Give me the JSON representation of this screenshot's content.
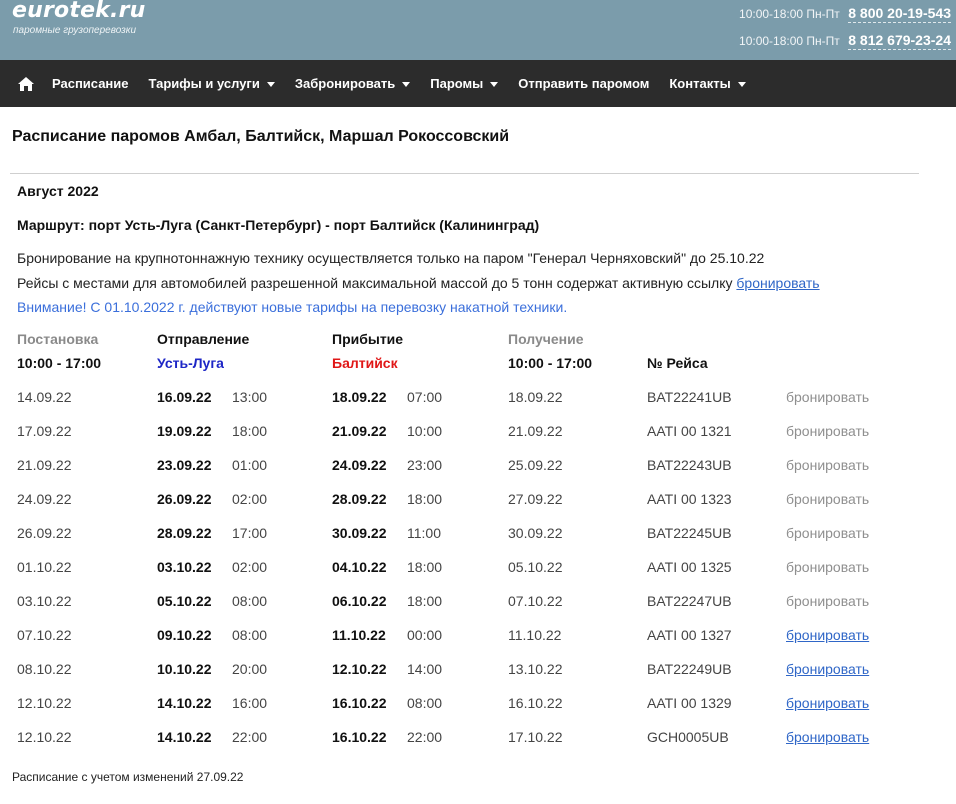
{
  "header": {
    "logo": "eurotek.ru",
    "slogan": "паромные грузоперевозки",
    "phones": [
      {
        "hours": "10:00-18:00 Пн-Пт",
        "number": "8 800 20-19-543"
      },
      {
        "hours": "10:00-18:00 Пн-Пт",
        "number": "8 812 679-23-24"
      }
    ]
  },
  "nav": {
    "home_icon": "home-icon",
    "items": [
      {
        "label": "Расписание",
        "dropdown": false
      },
      {
        "label": "Тарифы и услуги",
        "dropdown": true
      },
      {
        "label": "Забронировать",
        "dropdown": true
      },
      {
        "label": "Паромы",
        "dropdown": true
      },
      {
        "label": "Отправить паромом",
        "dropdown": false
      },
      {
        "label": "Контакты",
        "dropdown": true
      }
    ]
  },
  "page": {
    "title": "Расписание паромов Амбал, Балтийск, Маршал Рокоссовский",
    "month": "Август 2022",
    "route": "Маршрут: порт Усть-Луга (Санкт-Петербург) - порт Балтийск (Калининград)",
    "note1": "Бронирование на крупнотоннажную технику осуществляется только на паром \"Генерал Черняховский\" до 25.10.22",
    "note2_text": "Рейсы с местами для автомобилей разрешенной максимальной массой до 5 тонн содержат активную ссылку",
    "note2_link": "бронировать",
    "note3": "Внимание! С 01.10.2022 г. действуют новые тарифы на перевозку накатной техники."
  },
  "table": {
    "headers": {
      "loading": "Постановка",
      "departure": "Отправление",
      "arrival": "Прибытие",
      "pickup": "Получение"
    },
    "subheaders": {
      "loading_time": "10:00 - 17:00",
      "departure_port": "Усть-Луга",
      "arrival_port": "Балтийск",
      "pickup_time": "10:00 - 17:00",
      "voyage_no": "№ Рейса"
    },
    "rows": [
      {
        "loading": "14.09.22",
        "dep_date": "16.09.22",
        "dep_time": "13:00",
        "arr_date": "18.09.22",
        "arr_time": "07:00",
        "pickup": "18.09.22",
        "voyage": "BAT22241UB",
        "book": "бронировать",
        "active": false
      },
      {
        "loading": "17.09.22",
        "dep_date": "19.09.22",
        "dep_time": "18:00",
        "arr_date": "21.09.22",
        "arr_time": "10:00",
        "pickup": "21.09.22",
        "voyage": "AATI 00 1321",
        "book": "бронировать",
        "active": false
      },
      {
        "loading": "21.09.22",
        "dep_date": "23.09.22",
        "dep_time": "01:00",
        "arr_date": "24.09.22",
        "arr_time": "23:00",
        "pickup": "25.09.22",
        "voyage": "BAT22243UB",
        "book": "бронировать",
        "active": false
      },
      {
        "loading": "24.09.22",
        "dep_date": "26.09.22",
        "dep_time": "02:00",
        "arr_date": "28.09.22",
        "arr_time": "18:00",
        "pickup": "27.09.22",
        "voyage": "AATI 00 1323",
        "book": "бронировать",
        "active": false
      },
      {
        "loading": "26.09.22",
        "dep_date": "28.09.22",
        "dep_time": "17:00",
        "arr_date": "30.09.22",
        "arr_time": "11:00",
        "pickup": "30.09.22",
        "voyage": "BAT22245UB",
        "book": "бронировать",
        "active": false
      },
      {
        "loading": "01.10.22",
        "dep_date": "03.10.22",
        "dep_time": "02:00",
        "arr_date": "04.10.22",
        "arr_time": "18:00",
        "pickup": "05.10.22",
        "voyage": "AATI 00 1325",
        "book": "бронировать",
        "active": false
      },
      {
        "loading": "03.10.22",
        "dep_date": "05.10.22",
        "dep_time": "08:00",
        "arr_date": "06.10.22",
        "arr_time": "18:00",
        "pickup": "07.10.22",
        "voyage": "BAT22247UB",
        "book": "бронировать",
        "active": false
      },
      {
        "loading": "07.10.22",
        "dep_date": "09.10.22",
        "dep_time": "08:00",
        "arr_date": "11.10.22",
        "arr_time": "00:00",
        "pickup": "11.10.22",
        "voyage": "AATI 00 1327",
        "book": "бронировать",
        "active": true
      },
      {
        "loading": "08.10.22",
        "dep_date": "10.10.22",
        "dep_time": "20:00",
        "arr_date": "12.10.22",
        "arr_time": "14:00",
        "pickup": "13.10.22",
        "voyage": "BAT22249UB",
        "book": "бронировать",
        "active": true
      },
      {
        "loading": "12.10.22",
        "dep_date": "14.10.22",
        "dep_time": "16:00",
        "arr_date": "16.10.22",
        "arr_time": "08:00",
        "pickup": "16.10.22",
        "voyage": "AATI 00 1329",
        "book": "бронировать",
        "active": true
      },
      {
        "loading": "12.10.22",
        "dep_date": "14.10.22",
        "dep_time": "22:00",
        "arr_date": "16.10.22",
        "arr_time": "22:00",
        "pickup": "17.10.22",
        "voyage": "GCH0005UB",
        "book": "бронировать",
        "active": true
      }
    ]
  },
  "footer": {
    "note": "Расписание с учетом изменений 27.09.22"
  }
}
